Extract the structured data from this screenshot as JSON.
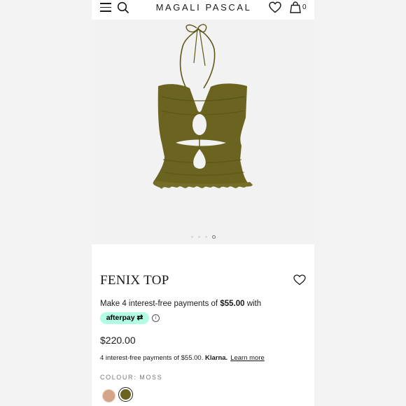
{
  "header": {
    "brand": "MAGALI PASCAL",
    "bag_count": "0",
    "icons": [
      "menu-icon",
      "search-icon",
      "heart-icon",
      "bag-icon"
    ]
  },
  "gallery": {
    "slide_count": 4,
    "active_index": 3
  },
  "product": {
    "title": "FENIX TOP",
    "afterpay_prefix": "Make 4 interest-free payments of ",
    "afterpay_amount": "$55.00",
    "afterpay_suffix": " with",
    "afterpay_badge": "afterpay",
    "info_glyph": "i",
    "price": "$220.00",
    "klarna_text": "4 interest-free payments of $55.00. ",
    "klarna_brand": "Klarna.",
    "learn_more": "Learn more",
    "colour_label": "COLOUR: MOSS",
    "swatches": [
      "nude",
      "moss"
    ],
    "selected_swatch": "moss"
  },
  "colors": {
    "product": "#6b6420",
    "afterpay_badge": "#b2fce4"
  }
}
